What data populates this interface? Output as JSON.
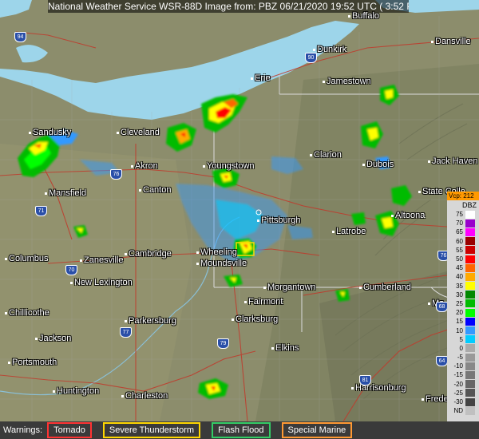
{
  "header": {
    "text": "National Weather Service WSR-88D Image from: PBZ 06/21/2020 19:52 UTC ( 3:52 PM EDT)"
  },
  "cities": [
    {
      "id": "buffalo",
      "name": "Buffalo"
    },
    {
      "id": "dunkirk",
      "name": "Dunkirk"
    },
    {
      "id": "danville",
      "name": "Dansville"
    },
    {
      "id": "jamestown",
      "name": "Jamestown"
    },
    {
      "id": "erie",
      "name": "Erie"
    },
    {
      "id": "sandusky",
      "name": "Sandusky"
    },
    {
      "id": "cleveland",
      "name": "Cleveland"
    },
    {
      "id": "akron",
      "name": "Akron"
    },
    {
      "id": "youngstown",
      "name": "Youngstown"
    },
    {
      "id": "canton",
      "name": "Canton"
    },
    {
      "id": "mansfield",
      "name": "Mansfield"
    },
    {
      "id": "clarion",
      "name": "Clarion"
    },
    {
      "id": "dubois",
      "name": "Dubois"
    },
    {
      "id": "jackhaven",
      "name": "Jack Haven"
    },
    {
      "id": "statecollege",
      "name": "State Colle"
    },
    {
      "id": "altoona",
      "name": "Altoona"
    },
    {
      "id": "pittsburgh",
      "name": "Pittsburgh"
    },
    {
      "id": "latrobe",
      "name": "Latrobe"
    },
    {
      "id": "columbus",
      "name": "Columbus"
    },
    {
      "id": "zanesville",
      "name": "Zanesville"
    },
    {
      "id": "cambridge",
      "name": "Cambridge"
    },
    {
      "id": "wheeling",
      "name": "Wheeling"
    },
    {
      "id": "moundsville",
      "name": "Moundsville"
    },
    {
      "id": "newlexington",
      "name": "New Lexington"
    },
    {
      "id": "morgantown",
      "name": "Morgantown"
    },
    {
      "id": "cumberland",
      "name": "Cumberland"
    },
    {
      "id": "fairmont",
      "name": "Fairmont"
    },
    {
      "id": "chillicothe",
      "name": "Chillicothe"
    },
    {
      "id": "parkersburg",
      "name": "Parkersburg"
    },
    {
      "id": "clarksburg",
      "name": "Clarksburg"
    },
    {
      "id": "jackson",
      "name": "Jackson"
    },
    {
      "id": "elkins",
      "name": "Elkins"
    },
    {
      "id": "portsmouth",
      "name": "Portsmouth"
    },
    {
      "id": "huntington",
      "name": "Huntington"
    },
    {
      "id": "charleston",
      "name": "Charleston"
    },
    {
      "id": "harrisonburg",
      "name": "Harrisonburg"
    },
    {
      "id": "frederick",
      "name": "Frederi"
    },
    {
      "id": "ma",
      "name": "Ma"
    }
  ],
  "shields": [
    {
      "id": "i94",
      "label": "94"
    },
    {
      "id": "i90",
      "label": "90"
    },
    {
      "id": "i76a",
      "label": "76"
    },
    {
      "id": "i71",
      "label": "71"
    },
    {
      "id": "i70",
      "label": "70"
    },
    {
      "id": "i77",
      "label": "77"
    },
    {
      "id": "i79",
      "label": "79"
    },
    {
      "id": "i76b",
      "label": "76"
    },
    {
      "id": "i81",
      "label": "81"
    },
    {
      "id": "i64",
      "label": "64"
    },
    {
      "id": "i68",
      "label": "68"
    }
  ],
  "legend": {
    "header": "Vcp: 212",
    "units": "DBZ",
    "rows": [
      {
        "label": "75",
        "color": "#ffffff"
      },
      {
        "label": "70",
        "color": "#9900cc"
      },
      {
        "label": "65",
        "color": "#ff00ff"
      },
      {
        "label": "60",
        "color": "#990000"
      },
      {
        "label": "55",
        "color": "#cc0000"
      },
      {
        "label": "50",
        "color": "#ff0000"
      },
      {
        "label": "45",
        "color": "#ff6600"
      },
      {
        "label": "40",
        "color": "#ffaa00"
      },
      {
        "label": "35",
        "color": "#ffff00"
      },
      {
        "label": "30",
        "color": "#008800"
      },
      {
        "label": "25",
        "color": "#00bb00"
      },
      {
        "label": "20",
        "color": "#00ff00"
      },
      {
        "label": "15",
        "color": "#0000ff"
      },
      {
        "label": "10",
        "color": "#3399ff"
      },
      {
        "label": "5",
        "color": "#00ccff"
      },
      {
        "label": "0",
        "color": "#aaaaaa"
      },
      {
        "label": "-5",
        "color": "#999999"
      },
      {
        "label": "-10",
        "color": "#888888"
      },
      {
        "label": "-15",
        "color": "#777777"
      },
      {
        "label": "-20",
        "color": "#666666"
      },
      {
        "label": "-25",
        "color": "#555555"
      },
      {
        "label": "-30",
        "color": "#444444"
      },
      {
        "label": "ND",
        "color": "#c0c0c0"
      }
    ]
  },
  "warnings": {
    "label": "Warnings:",
    "items": [
      {
        "name": "Tornado",
        "color": "#ff3333"
      },
      {
        "name": "Severe Thunderstorm",
        "color": "#ffd700"
      },
      {
        "name": "Flash Flood",
        "color": "#33cc66"
      },
      {
        "name": "Special Marine",
        "color": "#ff9933"
      }
    ]
  }
}
